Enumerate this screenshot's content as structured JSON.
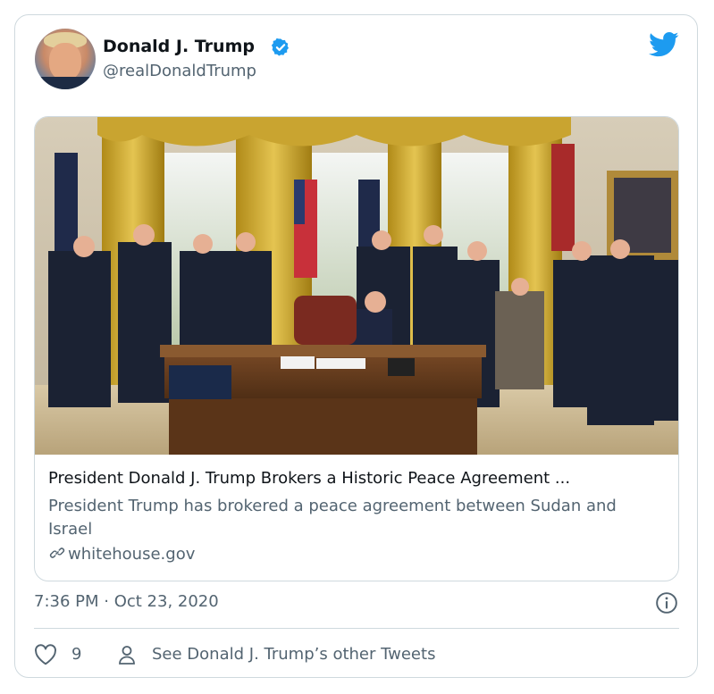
{
  "author": {
    "name": "Donald J. Trump",
    "handle": "@realDonaldTrump",
    "verified": true,
    "avatar_icon": "avatar-photo"
  },
  "platform_icon": "twitter-bird-icon",
  "card": {
    "image_description_icon": "photo",
    "title": "President Donald J. Trump Brokers a Historic Peace Agreement ...",
    "description": "President Trump has brokered a peace agreement between Sudan and Israel",
    "domain": "whitehouse.gov"
  },
  "timestamp": "7:36 PM · Oct 23, 2020",
  "actions": {
    "like_count": "9",
    "other_tweets_label": "See Donald J. Trump’s other Tweets"
  },
  "colors": {
    "text_primary": "#0f1419",
    "text_secondary": "#536471",
    "border": "#cfd9de",
    "twitter_blue": "#1d9bf0"
  }
}
